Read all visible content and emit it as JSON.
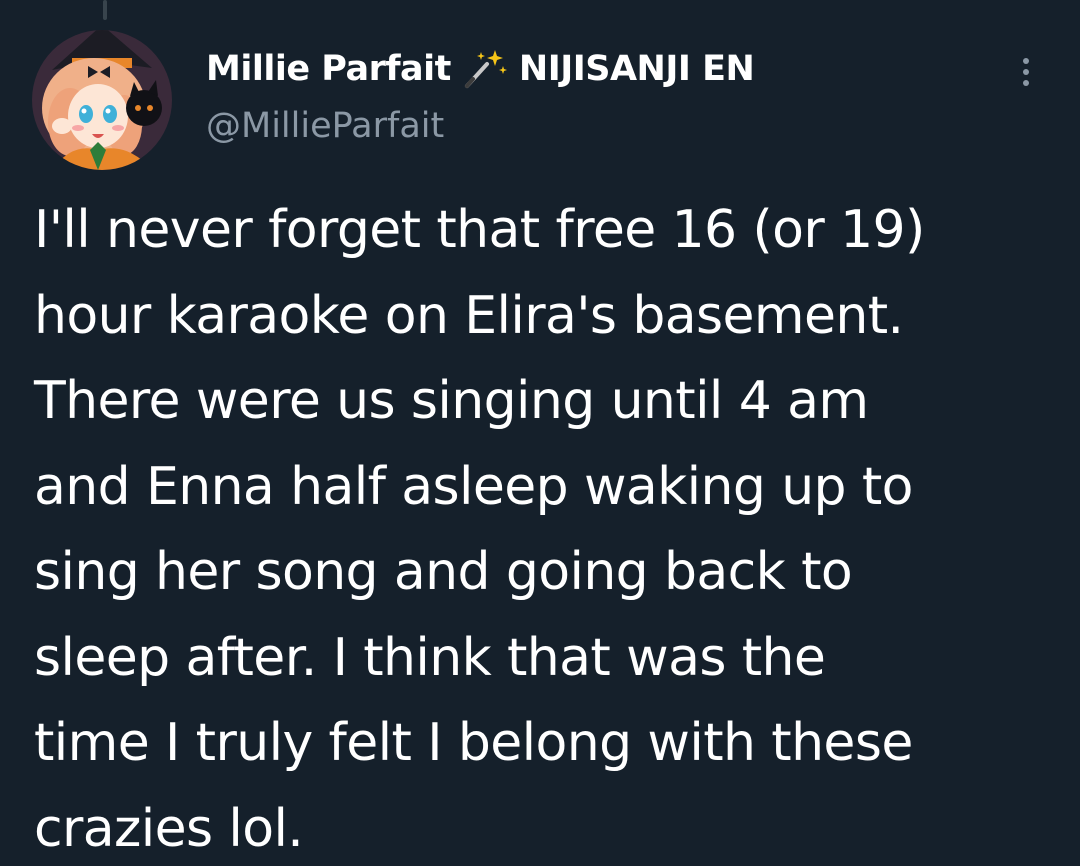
{
  "tweet": {
    "author": {
      "display_name": "Millie Parfait",
      "badge_emoji": "magic-wand-icon",
      "affiliation": "NIJISANJI EN",
      "handle": "@MillieParfait"
    },
    "text_lines": [
      "I'll never forget that free 16 (or 19)",
      "hour karaoke on Elira's basement.",
      "There were us singing until 4 am",
      "and Enna half asleep waking up to",
      "sing her song and going back to",
      "sleep after. I think that was the",
      "time I truly felt I belong with these",
      "crazies lol."
    ]
  },
  "colors": {
    "background": "#15202b",
    "primary_text": "#ffffff",
    "secondary_text": "#8b98a5"
  }
}
